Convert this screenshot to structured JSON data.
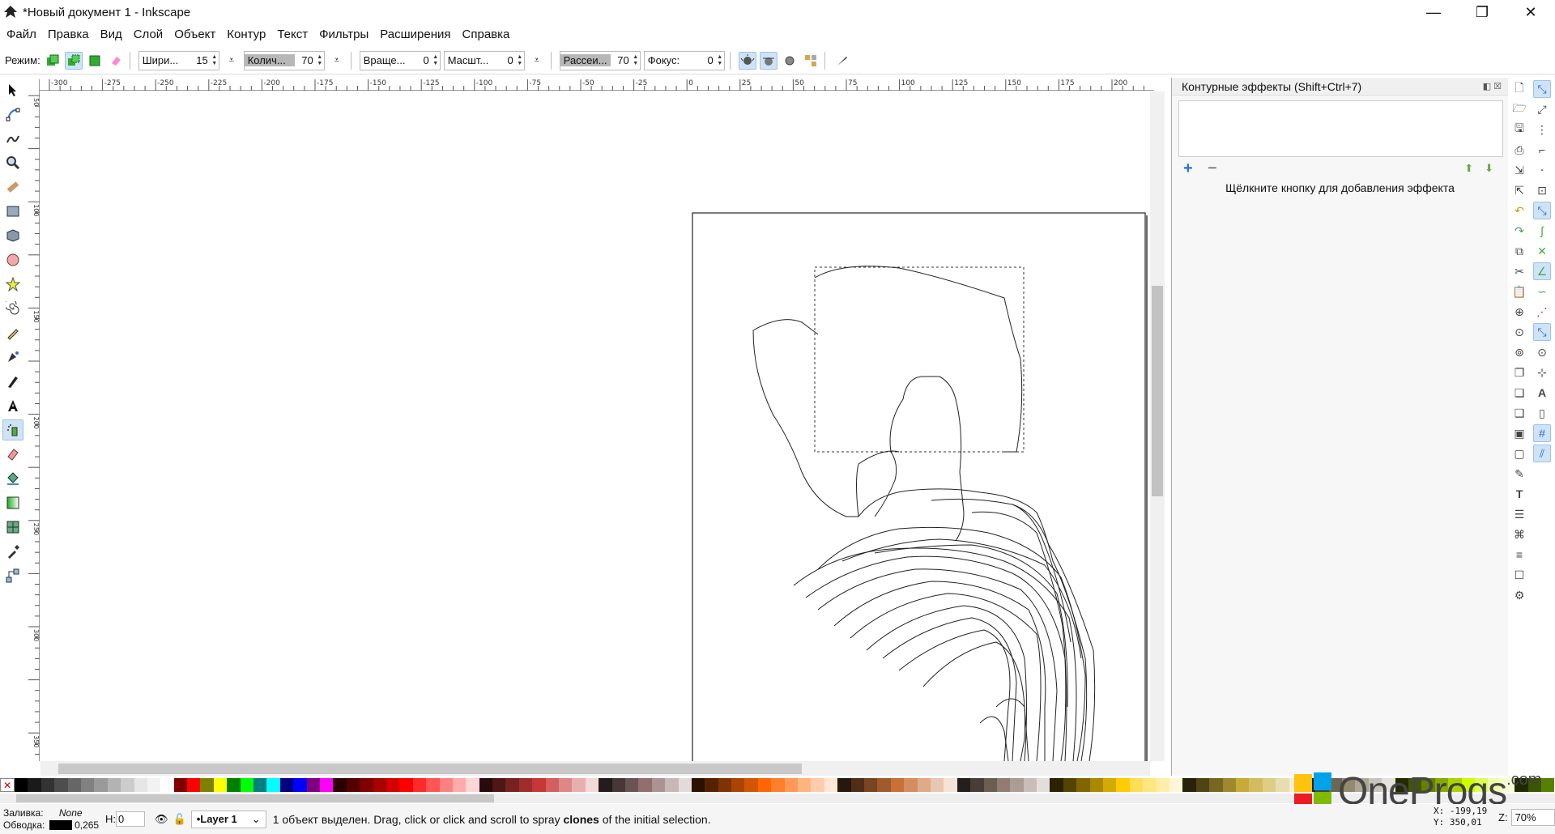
{
  "window": {
    "title": "*Новый документ 1 - Inkscape",
    "minimize": "—",
    "restore": "❐",
    "close": "✕"
  },
  "menu": [
    "Файл",
    "Правка",
    "Вид",
    "Слой",
    "Объект",
    "Контур",
    "Текст",
    "Фильтры",
    "Расширения",
    "Справка"
  ],
  "tool_controls": {
    "mode_label": "Режим:",
    "width_label": "Шири...",
    "width_value": "15",
    "amount_label": "Колич...",
    "amount_value": "70",
    "rotation_label": "Враще...",
    "rotation_value": "0",
    "scale_label": "Масшт...",
    "scale_value": "0",
    "scatter_label": "Рассеи...",
    "scatter_value": "70",
    "focus_label": "Фокус:",
    "focus_value": "0"
  },
  "horizontal_ruler": {
    "ticks": [
      "-300",
      "-275",
      "-250",
      "-225",
      "-200",
      "-175",
      "-150",
      "-125",
      "-100",
      "-75",
      "-50",
      "-25",
      "0",
      "25",
      "50",
      "75",
      "100",
      "125",
      "150",
      "175",
      "200"
    ]
  },
  "vertical_ruler": {
    "ticks": [
      "50",
      "",
      "100",
      "",
      "150",
      "",
      "200",
      "",
      "250",
      "",
      "300",
      "",
      "350"
    ]
  },
  "panel": {
    "title": "Контурные эффекты (Shift+Ctrl+7)",
    "add_label": "+",
    "remove_label": "−",
    "hint": "Щёлкните кнопку для добавления эффекта"
  },
  "palette": {
    "none_symbol": "✕",
    "colors": [
      "#000000",
      "#1a1a1a",
      "#333333",
      "#4d4d4d",
      "#666666",
      "#808080",
      "#999999",
      "#b3b3b3",
      "#cccccc",
      "#e6e6e6",
      "#f2f2f2",
      "#ffffff",
      "#800000",
      "#ff0000",
      "#808000",
      "#ffff00",
      "#008000",
      "#00ff00",
      "#008080",
      "#00ffff",
      "#000080",
      "#0000ff",
      "#800080",
      "#ff00ff",
      "#2b0000",
      "#550000",
      "#800000",
      "#aa0000",
      "#d40000",
      "#ff0000",
      "#ff2a2a",
      "#ff5555",
      "#ff8080",
      "#ffaaaa",
      "#ffd5d5",
      "#280b0b",
      "#501616",
      "#782121",
      "#a02c2c",
      "#c83737",
      "#d35f5f",
      "#de8787",
      "#e9afaf",
      "#f4d7d7",
      "#241c1c",
      "#483737",
      "#6c5353",
      "#916f6f",
      "#ac9393",
      "#c8b7b7",
      "#e3dbdb",
      "#2b1100",
      "#552200",
      "#803300",
      "#aa4400",
      "#d45500",
      "#ff6600",
      "#ff7f2a",
      "#ff9955",
      "#ffb380",
      "#ffccaa",
      "#ffe6d5",
      "#28170b",
      "#502d16",
      "#784421",
      "#a05a2c",
      "#c87137",
      "#d38d5f",
      "#deaa87",
      "#e9c6af",
      "#f4e3d7",
      "#241f1c",
      "#483e37",
      "#6c5d53",
      "#917c6f",
      "#ac9d93",
      "#c8beb7",
      "#e3dedb",
      "#2b2200",
      "#554400",
      "#806600",
      "#aa8800",
      "#d4aa00",
      "#ffcc00",
      "#ffdd55",
      "#ffe680",
      "#ffeeaa",
      "#fff6d5",
      "#28220b",
      "#504416",
      "#786721",
      "#a0892c",
      "#c8ab37",
      "#d3bc5f",
      "#decd87",
      "#e9ddaf",
      "#f4eed7",
      "#24221c",
      "#484537",
      "#6c6753",
      "#918a6f",
      "#aca793",
      "#c8c4b7",
      "#e3e2db",
      "#222b00",
      "#445500",
      "#668000",
      "#88aa00",
      "#aad400",
      "#ccff00",
      "#ddff55",
      "#eeffaa",
      "#f6ffd5",
      "#1e2b00",
      "#395500",
      "#558000"
    ]
  },
  "status": {
    "fill_label": "Заливка:",
    "fill_value": "None",
    "stroke_label": "Обводка:",
    "stroke_width": "0,265",
    "h_label": "Н:",
    "h_value": "0",
    "layer": "•Layer 1",
    "message_prefix": "1 объект выделен. Drag, click or click and scroll to spray",
    "message_bold": "clones",
    "message_suffix": "of the initial selection.",
    "x": "X: -199,19",
    "y": "Y:  350,01",
    "zoom_label": "Z:",
    "zoom_value": "70%"
  },
  "watermark": {
    "text": "OneProgs",
    "suffix": ".com"
  }
}
